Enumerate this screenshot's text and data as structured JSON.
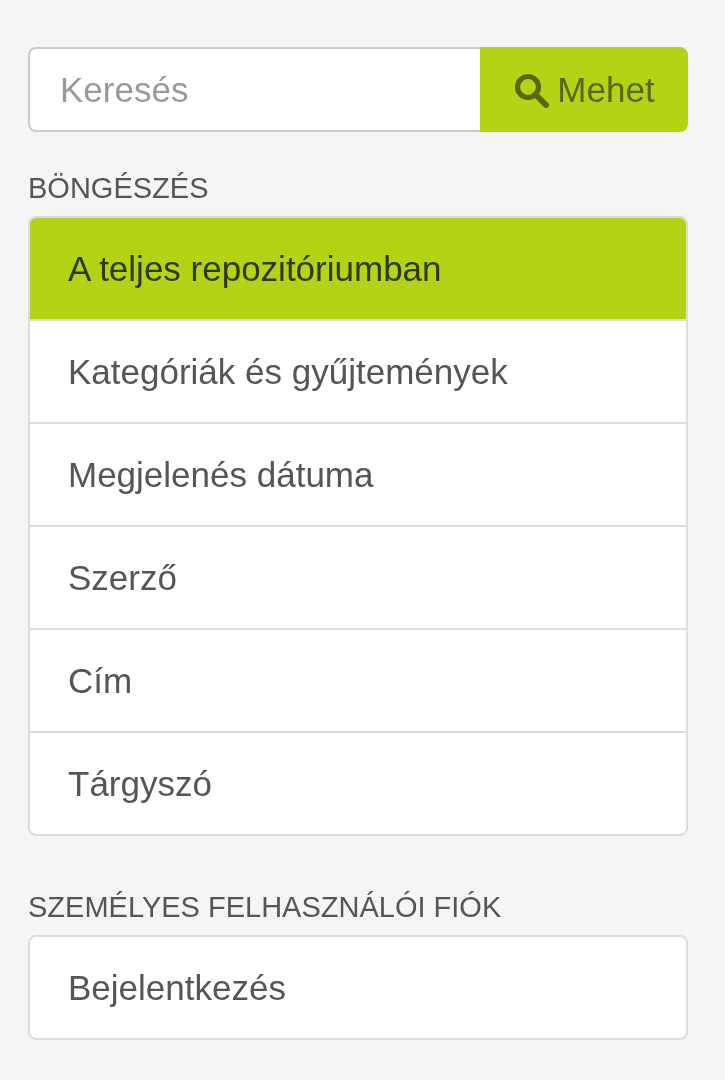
{
  "search": {
    "placeholder": "Keresés",
    "button": "Mehet"
  },
  "sections": [
    {
      "heading": "BÖNGÉSZÉS",
      "items": [
        {
          "label": "A teljes repozitóriumban",
          "selected": true
        },
        {
          "label": "Kategóriák és gyűjtemények",
          "selected": false
        },
        {
          "label": "Megjelenés dátuma",
          "selected": false
        },
        {
          "label": "Szerző",
          "selected": false
        },
        {
          "label": "Cím",
          "selected": false
        },
        {
          "label": "Tárgyszó",
          "selected": false
        }
      ]
    },
    {
      "heading": "SZEMÉLYES FELHASZNÁLÓI FIÓK",
      "items": [
        {
          "label": "Bejelentkezés",
          "selected": false
        }
      ]
    }
  ]
}
